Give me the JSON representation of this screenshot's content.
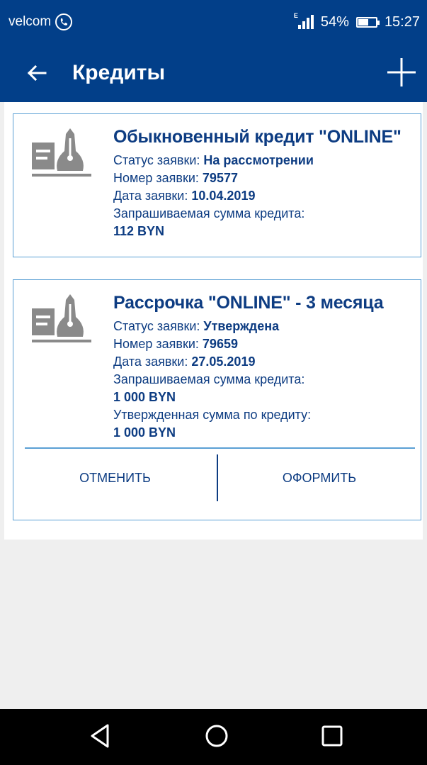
{
  "status_bar": {
    "carrier": "velcom",
    "network": "E",
    "battery": "54%",
    "battery_level": 0.54,
    "time": "15:27"
  },
  "app_bar": {
    "title": "Кредиты"
  },
  "icons": {
    "back": "arrow-left-icon",
    "add": "plus-icon",
    "credit": "pen-nib-card-icon",
    "nav_back": "triangle-back-icon",
    "nav_home": "circle-home-icon",
    "nav_recent": "square-recent-icon"
  },
  "colors": {
    "primary": "#023f89",
    "text": "#0d3c82",
    "border": "#5a9fd4",
    "icon_gray": "#8a8a8a"
  },
  "cards": [
    {
      "title": "Обыкновенный кредит \"ONLINE\"",
      "status_label": "Статус заявки: ",
      "status_value": "На рассмотрении",
      "number_label": "Номер заявки: ",
      "number_value": "79577",
      "date_label": "Дата заявки: ",
      "date_value": "10.04.2019",
      "requested_label": "Запрашиваемая сумма кредита:",
      "requested_value": "112 BYN"
    },
    {
      "title": "Рассрочка \"ONLINE\" - 3 месяца",
      "status_label": "Статус заявки: ",
      "status_value": "Утверждена",
      "number_label": "Номер заявки: ",
      "number_value": "79659",
      "date_label": "Дата заявки: ",
      "date_value": "27.05.2019",
      "requested_label": "Запрашиваемая сумма кредита:",
      "requested_value": "1 000 BYN",
      "approved_label": "Утвержденная сумма по кредиту:",
      "approved_value": "1 000 BYN",
      "cancel_label": "ОТМЕНИТЬ",
      "apply_label": "ОФОРМИТЬ"
    }
  ]
}
